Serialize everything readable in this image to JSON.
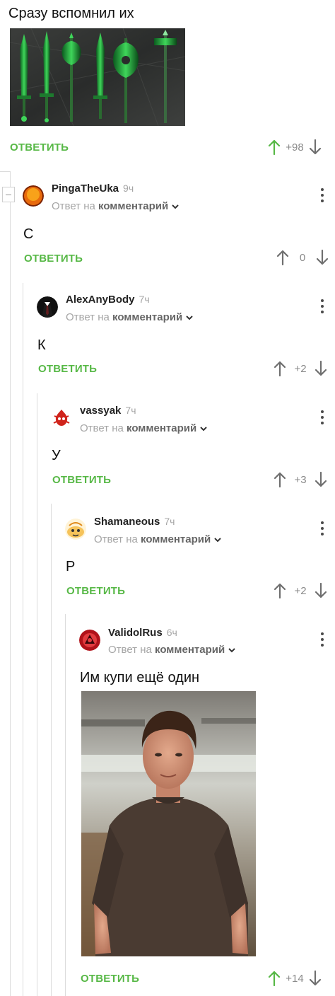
{
  "post": {
    "text": "Сразу вспомнил их",
    "reply_label": "ОТВЕТИТЬ",
    "score": "+98"
  },
  "reply_prefix": "Ответ на",
  "reply_target": "комментарий",
  "colors": {
    "accent_green": "#57b846",
    "muted_gray": "#a5a5a5",
    "arrow_gray": "#6f6f6f",
    "upvote_green": "#57b846"
  },
  "comments": [
    {
      "username": "PingaTheUka",
      "time": "9ч",
      "text": "С",
      "reply_label": "ОТВЕТИТЬ",
      "score": "0"
    },
    {
      "username": "AlexAnyBody",
      "time": "7ч",
      "text": "К",
      "reply_label": "ОТВЕТИТЬ",
      "score": "+2"
    },
    {
      "username": "vassyak",
      "time": "7ч",
      "text": "У",
      "reply_label": "ОТВЕТИТЬ",
      "score": "+3"
    },
    {
      "username": "Shamaneous",
      "time": "7ч",
      "text": "Р",
      "reply_label": "ОТВЕТИТЬ",
      "score": "+2"
    },
    {
      "username": "ValidolRus",
      "time": "6ч",
      "text": "Им купи ещё один",
      "reply_label": "ОТВЕТИТЬ",
      "score": "+14"
    }
  ],
  "icons": {
    "upvote": "arrow-up-icon",
    "downvote": "arrow-down-icon",
    "more": "more-vertical-icon",
    "chevron": "chevron-down-icon",
    "collapse": "collapse-thread-icon"
  }
}
